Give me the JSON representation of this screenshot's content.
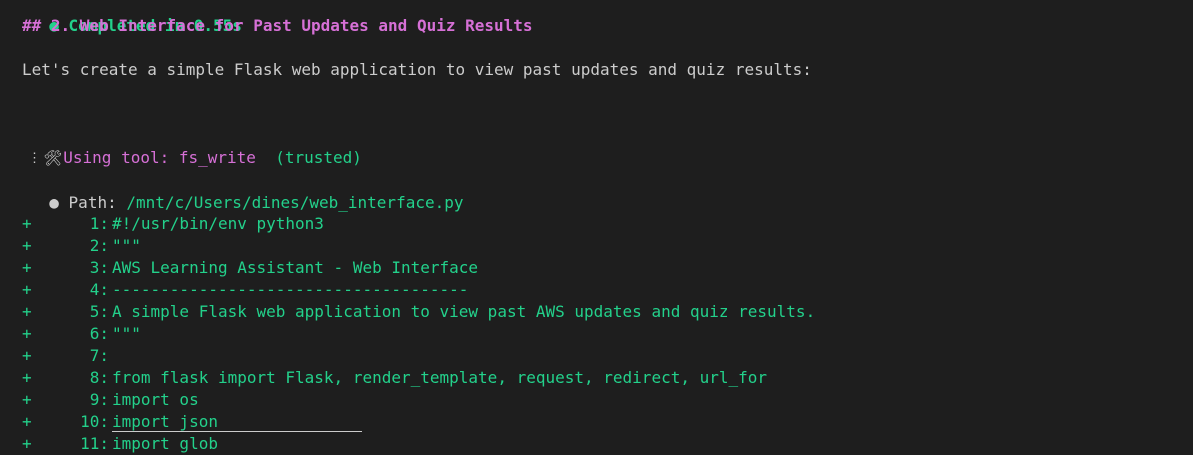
{
  "status": {
    "bullet": "●",
    "text": "Completed in 0.55s"
  },
  "heading": "## 2. Web Interface for Past Updates and Quiz Results",
  "intro": "Let's create a simple Flask web application to view past updates and quiz results:",
  "tool": {
    "icon": "hammer-wrench-icon",
    "prefix": "Using tool: ",
    "name": "fs_write",
    "trusted": "(trusted)"
  },
  "ellipsis": "⋮",
  "path": {
    "bullet": "●",
    "label": "Path: ",
    "value": "/mnt/c/Users/dines/web_interface.py"
  },
  "diff": {
    "marker": "+",
    "lines": [
      {
        "num": "1:",
        "code": "#!/usr/bin/env python3"
      },
      {
        "num": "2:",
        "code": "\"\"\""
      },
      {
        "num": "3:",
        "code": "AWS Learning Assistant - Web Interface"
      },
      {
        "num": "4:",
        "code": "-------------------------------------"
      },
      {
        "num": "5:",
        "code": "A simple Flask web application to view past AWS updates and quiz results."
      },
      {
        "num": "6:",
        "code": "\"\"\""
      },
      {
        "num": "7:",
        "code": ""
      },
      {
        "num": "8:",
        "code": "from flask import Flask, render_template, request, redirect, url_for"
      },
      {
        "num": "9:",
        "code": "import os"
      },
      {
        "num": "10:",
        "code": "import json"
      },
      {
        "num": "11:",
        "code": "import glob"
      }
    ]
  }
}
